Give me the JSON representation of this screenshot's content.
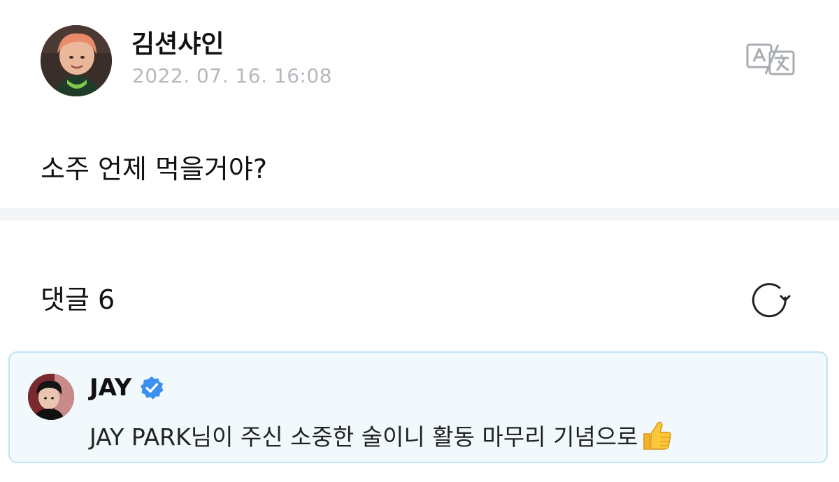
{
  "post": {
    "author": "김션샤인",
    "date": "2022. 07. 16. 16:08",
    "body": "소주 언제 먹을거야?",
    "translate_icon": "translate-icon"
  },
  "comments": {
    "title": "댓글 6",
    "refresh_icon": "refresh-icon",
    "items": [
      {
        "author": "JAY",
        "verified": true,
        "text": "JAY PARK님이 주신 소중한 술이니 활동 마무리 기념으로",
        "emoji": "thumbs-up-icon",
        "highlighted": true
      }
    ]
  },
  "colors": {
    "date_gray": "#b5b8bd",
    "divider_gray": "#f4f5f7",
    "highlight_bg": "#f1f9fd",
    "highlight_border": "#bfe3f2",
    "verified_blue": "#3b8ff0"
  }
}
